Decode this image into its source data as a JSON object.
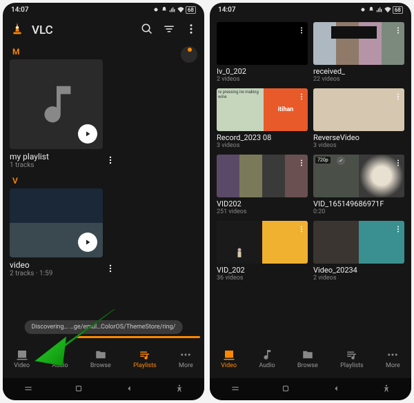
{
  "status": {
    "time": "14:07",
    "battery": "68"
  },
  "left": {
    "title": "VLC",
    "sections": {
      "m": "M",
      "v": "V"
    },
    "playlist1": {
      "title": "my playlist",
      "meta": "1 tracks"
    },
    "playlist2": {
      "title": "video",
      "meta": "2 tracks · 1:59"
    },
    "scanning": "Discovering…   …ge/emul…ColorOS/ThemeStore/ring/",
    "nav": {
      "video": "Video",
      "audio": "Audio",
      "browse": "Browse",
      "playlists": "Playlists",
      "more": "More"
    }
  },
  "right": {
    "items": [
      {
        "title": "Iv_0_202",
        "meta": "2 videos"
      },
      {
        "title": "received_",
        "meta": "22 videos"
      },
      {
        "title": "Record_2023 08",
        "meta": "3 videos"
      },
      {
        "title": "ReverseVideo",
        "meta": "3 videos"
      },
      {
        "title": "VID202",
        "meta": "251 videos"
      },
      {
        "title": "VID_165149686971F",
        "meta": "0:20"
      },
      {
        "title": "VID_202",
        "meta": "36 videos"
      },
      {
        "title": "Video_20234",
        "meta": "2 videos"
      }
    ],
    "latihan_small": "re pressing\nire making\nwine",
    "latihan_big": "itihan",
    "badge720": "720p",
    "nav": {
      "video": "Video",
      "audio": "Audio",
      "browse": "Browse",
      "playlists": "Playlists",
      "more": "More"
    }
  }
}
